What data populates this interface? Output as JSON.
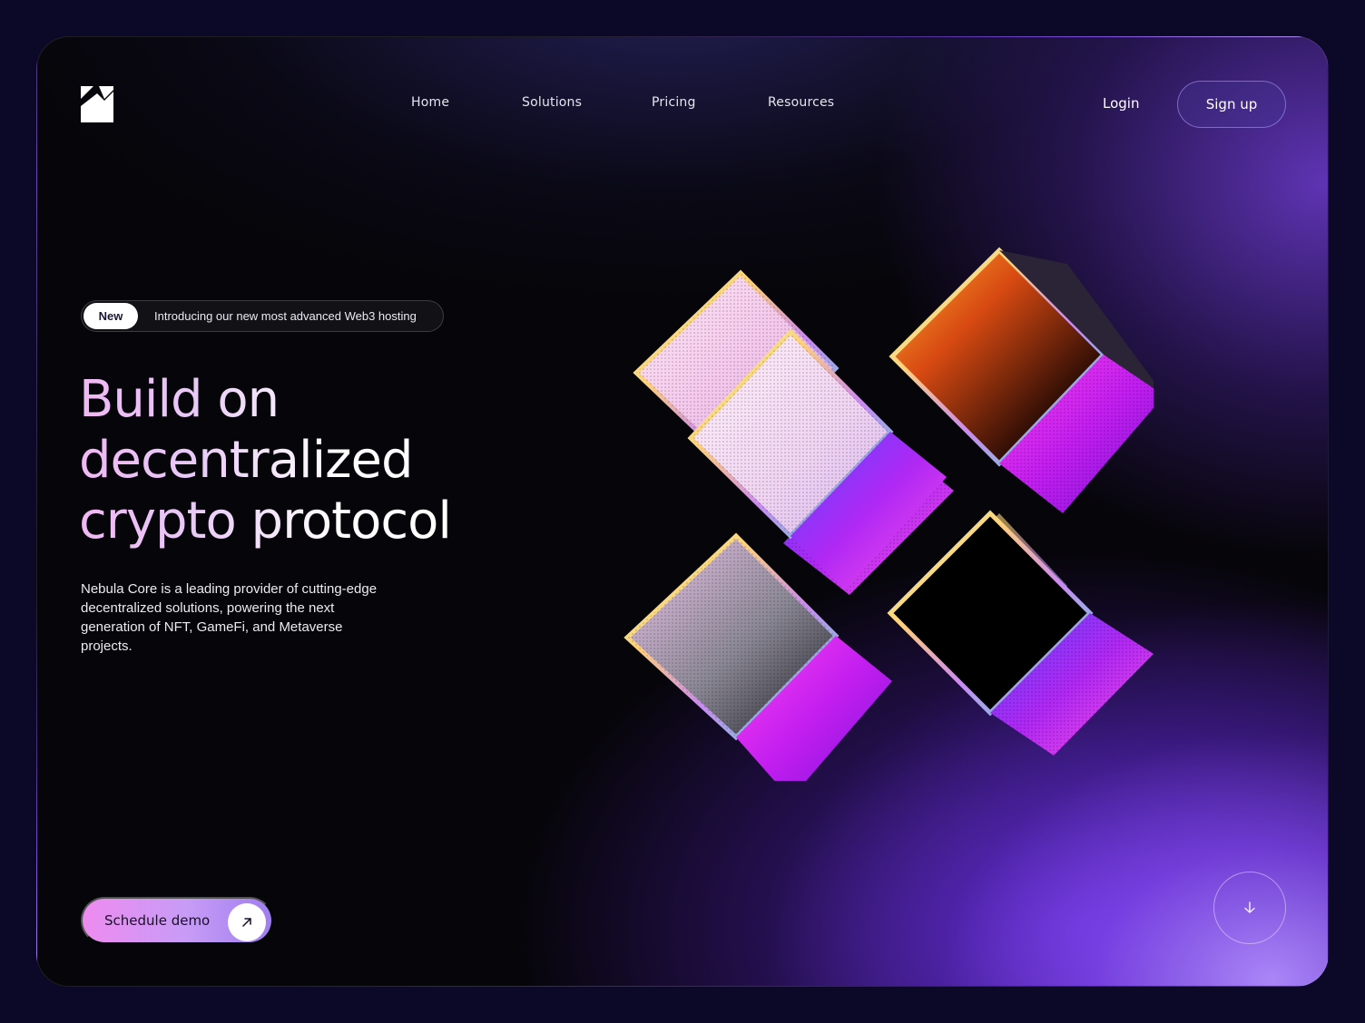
{
  "nav": {
    "items": [
      {
        "label": "Home"
      },
      {
        "label": "Solutions"
      },
      {
        "label": "Pricing"
      },
      {
        "label": "Resources"
      }
    ],
    "login_label": "Login",
    "signup_label": "Sign up"
  },
  "announcement": {
    "badge": "New",
    "text": "Introducing our new most advanced Web3 hosting"
  },
  "hero": {
    "title_lines": [
      "Build on",
      "decentralized",
      "crypto protocol"
    ],
    "description": "Nebula Core is a leading provider of cutting-edge decentralized solutions, powering the next generation of NFT, GameFi, and Metaverse projects."
  },
  "cta": {
    "label": "Schedule demo",
    "icon": "arrow-up-right-icon"
  },
  "scroll_button": {
    "icon": "arrow-down-icon"
  },
  "colors": {
    "background": "#0c0828",
    "accent_purple": "#7b4ff0",
    "accent_pink": "#ee8bf0",
    "title_gradient_start": "#f0b8f4"
  }
}
